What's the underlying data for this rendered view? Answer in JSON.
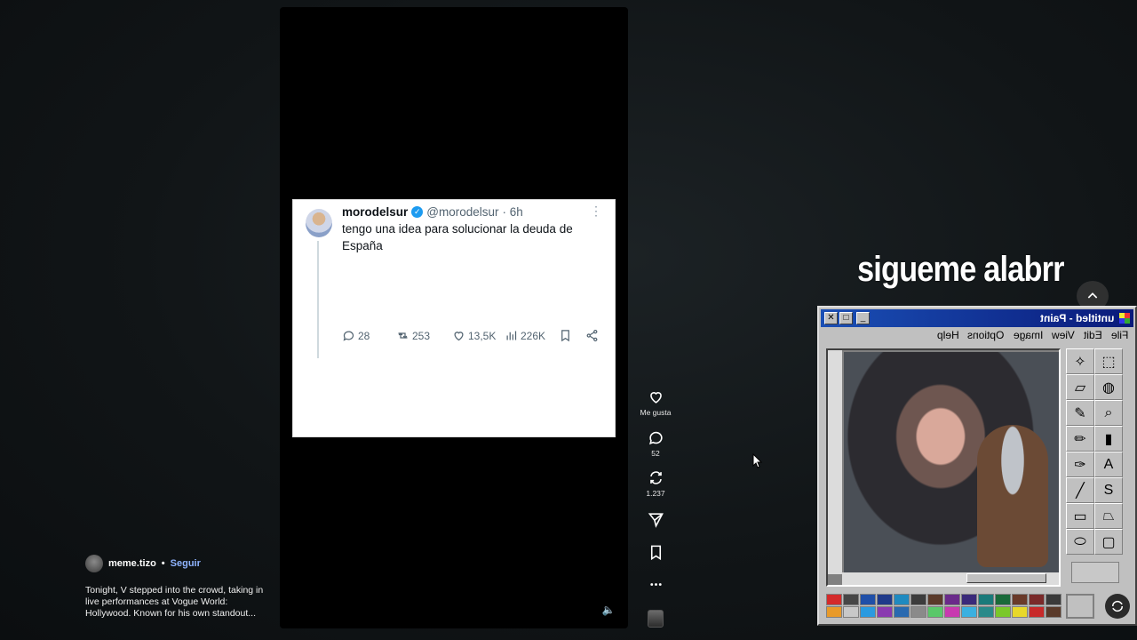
{
  "tweet": {
    "name": "morodelsur",
    "handle": "@morodelsur",
    "time": "· 6h",
    "text": "tengo una idea para solucionar la deuda de España",
    "replies": "28",
    "retweets": "253",
    "likes": "13,5K",
    "views": "226K"
  },
  "rail": {
    "like_label": "Me gusta",
    "comments_count": "52",
    "reposts_count": "1.237"
  },
  "creator": {
    "username": "meme.tizo",
    "separator": "•",
    "follow_label": "Seguir",
    "description": "Tonight, V stepped into the crowd, taking in live performances at Vogue World: Hollywood. Known for his own standout..."
  },
  "overlay_caption": "sigueme alabrr",
  "paint": {
    "title": "untitled - Paint",
    "menu": [
      "File",
      "Edit",
      "View",
      "Image",
      "Options",
      "Help"
    ],
    "tool_icons": [
      "free-select-icon",
      "select-icon",
      "eraser-icon",
      "fill-icon",
      "pick-color-icon",
      "magnifier-icon",
      "pencil-icon",
      "brush-icon",
      "airbrush-icon",
      "text-icon",
      "line-icon",
      "curve-icon",
      "rectangle-icon",
      "polygon-icon",
      "ellipse-icon",
      "rounded-rectangle-icon"
    ],
    "palette": [
      "#d42a2a",
      "#464646",
      "#1f4fa8",
      "#1f3a8a",
      "#1f8ac0",
      "#3c3c3c",
      "#5a3a2a",
      "#6a2a8a",
      "#3a2a7a",
      "#1a7a7a",
      "#1a6a3a",
      "#6a3a2a",
      "#7a2a2a",
      "#3a3a3a",
      "#e89a2a",
      "#c8c8c8",
      "#2a9ae0",
      "#8a3ab0",
      "#2a6ab0",
      "#8a8a8a",
      "#5ac86a",
      "#c83ab0",
      "#3ab0e0",
      "#2a8a8a",
      "#7ac82a",
      "#e8d82a",
      "#c82a2a",
      "#5a3a2a"
    ]
  }
}
